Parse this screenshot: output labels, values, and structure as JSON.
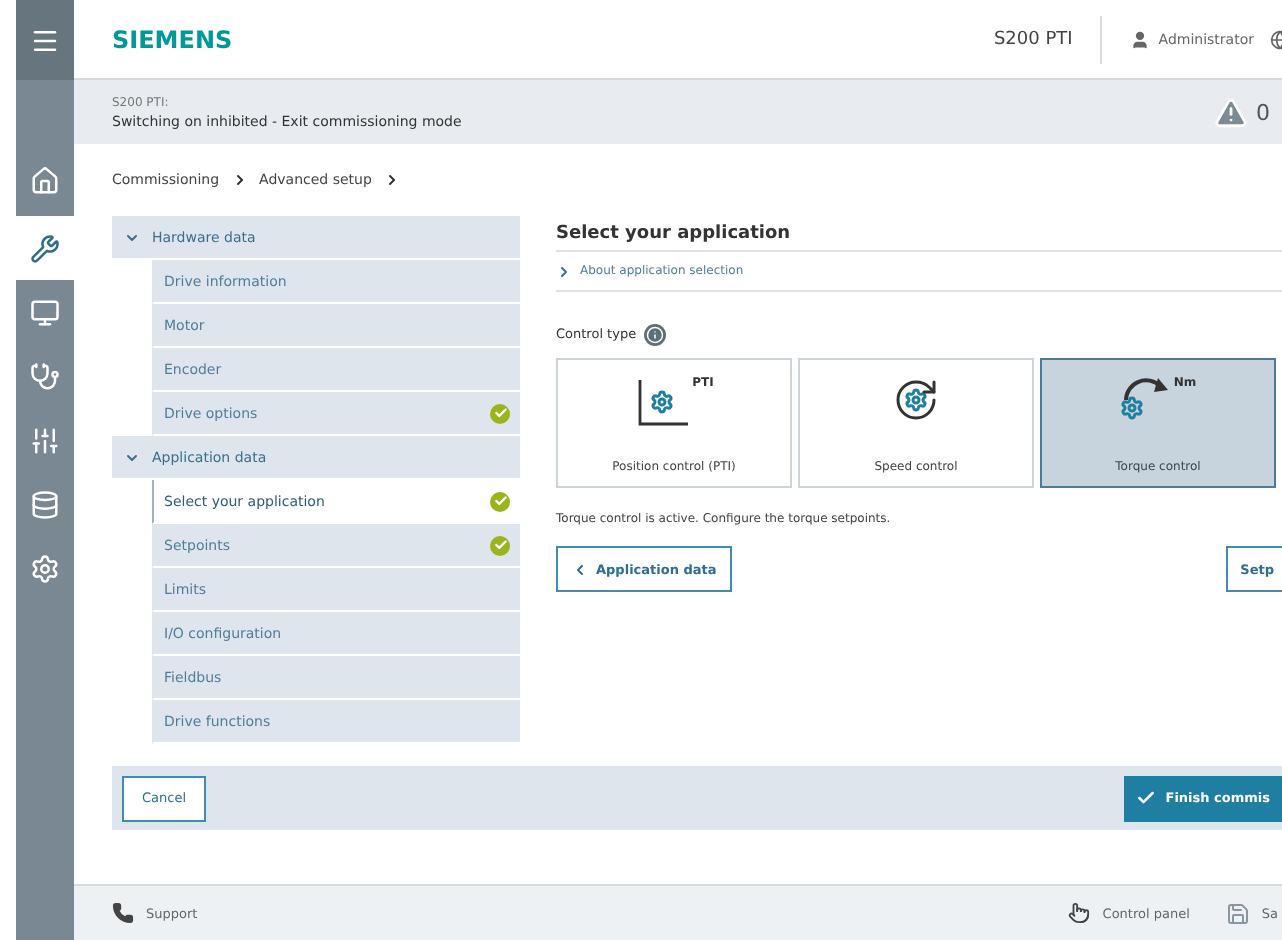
{
  "nav": [
    {
      "kind": "menu",
      "selected": false
    },
    {
      "kind": "home",
      "selected": false
    },
    {
      "kind": "tools",
      "selected": true
    },
    {
      "kind": "monitor",
      "selected": false
    },
    {
      "kind": "stethoscope",
      "selected": false
    },
    {
      "kind": "sliders",
      "selected": false
    },
    {
      "kind": "data",
      "selected": false
    },
    {
      "kind": "service",
      "selected": false
    }
  ],
  "header": {
    "brand": "SIEMENS",
    "device": "S200 PTI",
    "user": "Administrator"
  },
  "status": {
    "device": "S200 PTI:",
    "message": "Switching on inhibited - Exit commissioning mode",
    "warnings": "0"
  },
  "breadcrumb": [
    "Commissioning",
    "Advanced setup"
  ],
  "tree": [
    {
      "label": "Hardware data",
      "expanded": true,
      "children": [
        {
          "label": "Drive information",
          "done": false,
          "selected": false
        },
        {
          "label": "Motor",
          "done": false,
          "selected": false
        },
        {
          "label": "Encoder",
          "done": false,
          "selected": false
        },
        {
          "label": "Drive options",
          "done": true,
          "selected": false
        }
      ]
    },
    {
      "label": "Application data",
      "expanded": true,
      "children": [
        {
          "label": "Select your application",
          "done": true,
          "selected": true
        },
        {
          "label": "Setpoints",
          "done": true,
          "selected": false
        },
        {
          "label": "Limits",
          "done": false,
          "selected": false
        },
        {
          "label": "I/O configuration",
          "done": false,
          "selected": false
        },
        {
          "label": "Fieldbus",
          "done": false,
          "selected": false
        },
        {
          "label": "Drive functions",
          "done": false,
          "selected": false
        }
      ]
    }
  ],
  "content": {
    "title": "Select your application",
    "about": "About application selection",
    "control_type_label": "Control type",
    "cards": [
      {
        "kind": "position",
        "label": "Position control (PTI)",
        "badge": "PTI",
        "selected": false
      },
      {
        "kind": "speed",
        "label": "Speed control",
        "selected": false
      },
      {
        "kind": "torque",
        "label": "Torque control",
        "badge": "Nm",
        "selected": true
      }
    ],
    "message": "Torque control is active. Configure the torque setpoints.",
    "back_button": "Application data",
    "next_button": "Setp"
  },
  "actions": {
    "cancel": "Cancel",
    "finish": "Finish commis"
  },
  "footer": {
    "support": "Support",
    "control_panel": "Control panel",
    "save": "Sa"
  }
}
